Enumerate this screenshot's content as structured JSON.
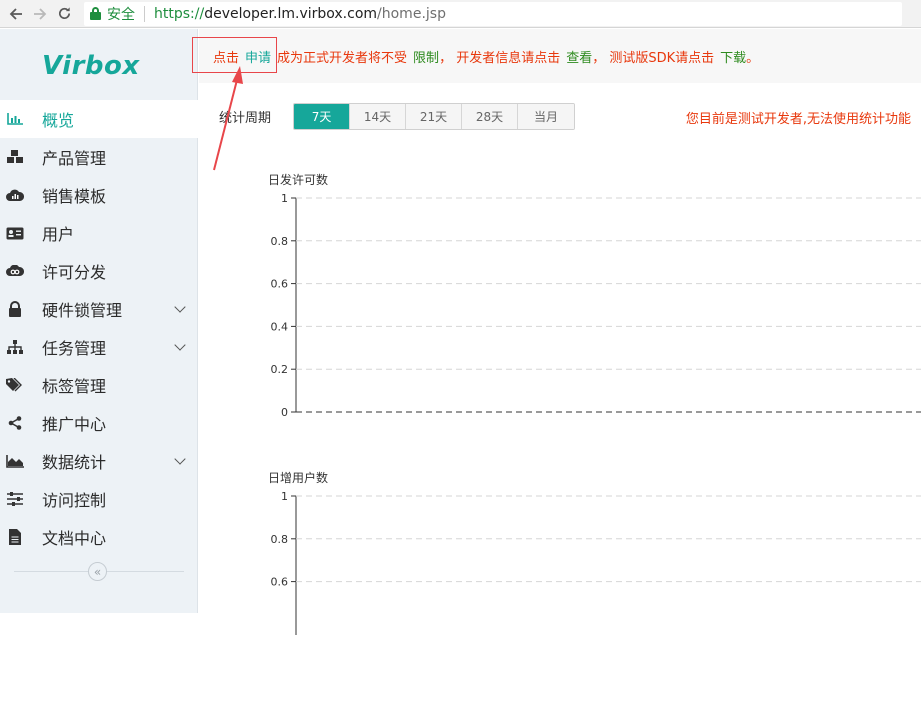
{
  "browser": {
    "secure_label": "安全",
    "url_scheme": "https://",
    "url_host": "developer.lm.virbox.com",
    "url_path": "/home.jsp"
  },
  "sidebar": {
    "logo": "Virbox",
    "items": [
      {
        "label": "概览",
        "icon": "bar-chart-icon",
        "active": true,
        "expandable": false
      },
      {
        "label": "产品管理",
        "icon": "cubes-icon",
        "active": false,
        "expandable": false
      },
      {
        "label": "销售模板",
        "icon": "cloud-chart-icon",
        "active": false,
        "expandable": false
      },
      {
        "label": "用户",
        "icon": "id-card-icon",
        "active": false,
        "expandable": false
      },
      {
        "label": "许可分发",
        "icon": "cloud-link-icon",
        "active": false,
        "expandable": false
      },
      {
        "label": "硬件锁管理",
        "icon": "lock-icon",
        "active": false,
        "expandable": true
      },
      {
        "label": "任务管理",
        "icon": "sitemap-icon",
        "active": false,
        "expandable": true
      },
      {
        "label": "标签管理",
        "icon": "tags-icon",
        "active": false,
        "expandable": false
      },
      {
        "label": "推广中心",
        "icon": "share-icon",
        "active": false,
        "expandable": false
      },
      {
        "label": "数据统计",
        "icon": "area-chart-icon",
        "active": false,
        "expandable": true
      },
      {
        "label": "访问控制",
        "icon": "sliders-icon",
        "active": false,
        "expandable": false
      },
      {
        "label": "文档中心",
        "icon": "file-icon",
        "active": false,
        "expandable": false
      }
    ],
    "collapse_symbol": "«"
  },
  "notice": {
    "part1": "点击",
    "apply_link": "申请",
    "part2": "成为正式开发者将不受",
    "limit_link": "限制",
    "part3": "， 开发者信息请点击",
    "view_link": "查看",
    "part4": "， 测试版SDK请点击",
    "download_link": "下载",
    "part5": "。"
  },
  "period": {
    "label": "统计周期",
    "options": [
      "7天",
      "14天",
      "21天",
      "28天",
      "当月"
    ],
    "selected": "7天"
  },
  "warning": "您目前是测试开发者,无法使用统计功能",
  "colors": {
    "accent": "#16a79a",
    "warning": "#e8380d",
    "link_green": "#2e8b1f"
  },
  "chart_data": [
    {
      "type": "line",
      "title": "日发许可数",
      "ylim": [
        0,
        1
      ],
      "yticks": [
        "1",
        "0.8",
        "0.6",
        "0.4",
        "0.2",
        "0"
      ],
      "series": [],
      "grid": true
    },
    {
      "type": "line",
      "title": "日增用户数",
      "ylim": [
        0,
        1
      ],
      "yticks": [
        "1",
        "0.8",
        "0.6"
      ],
      "series": [],
      "grid": true
    }
  ]
}
